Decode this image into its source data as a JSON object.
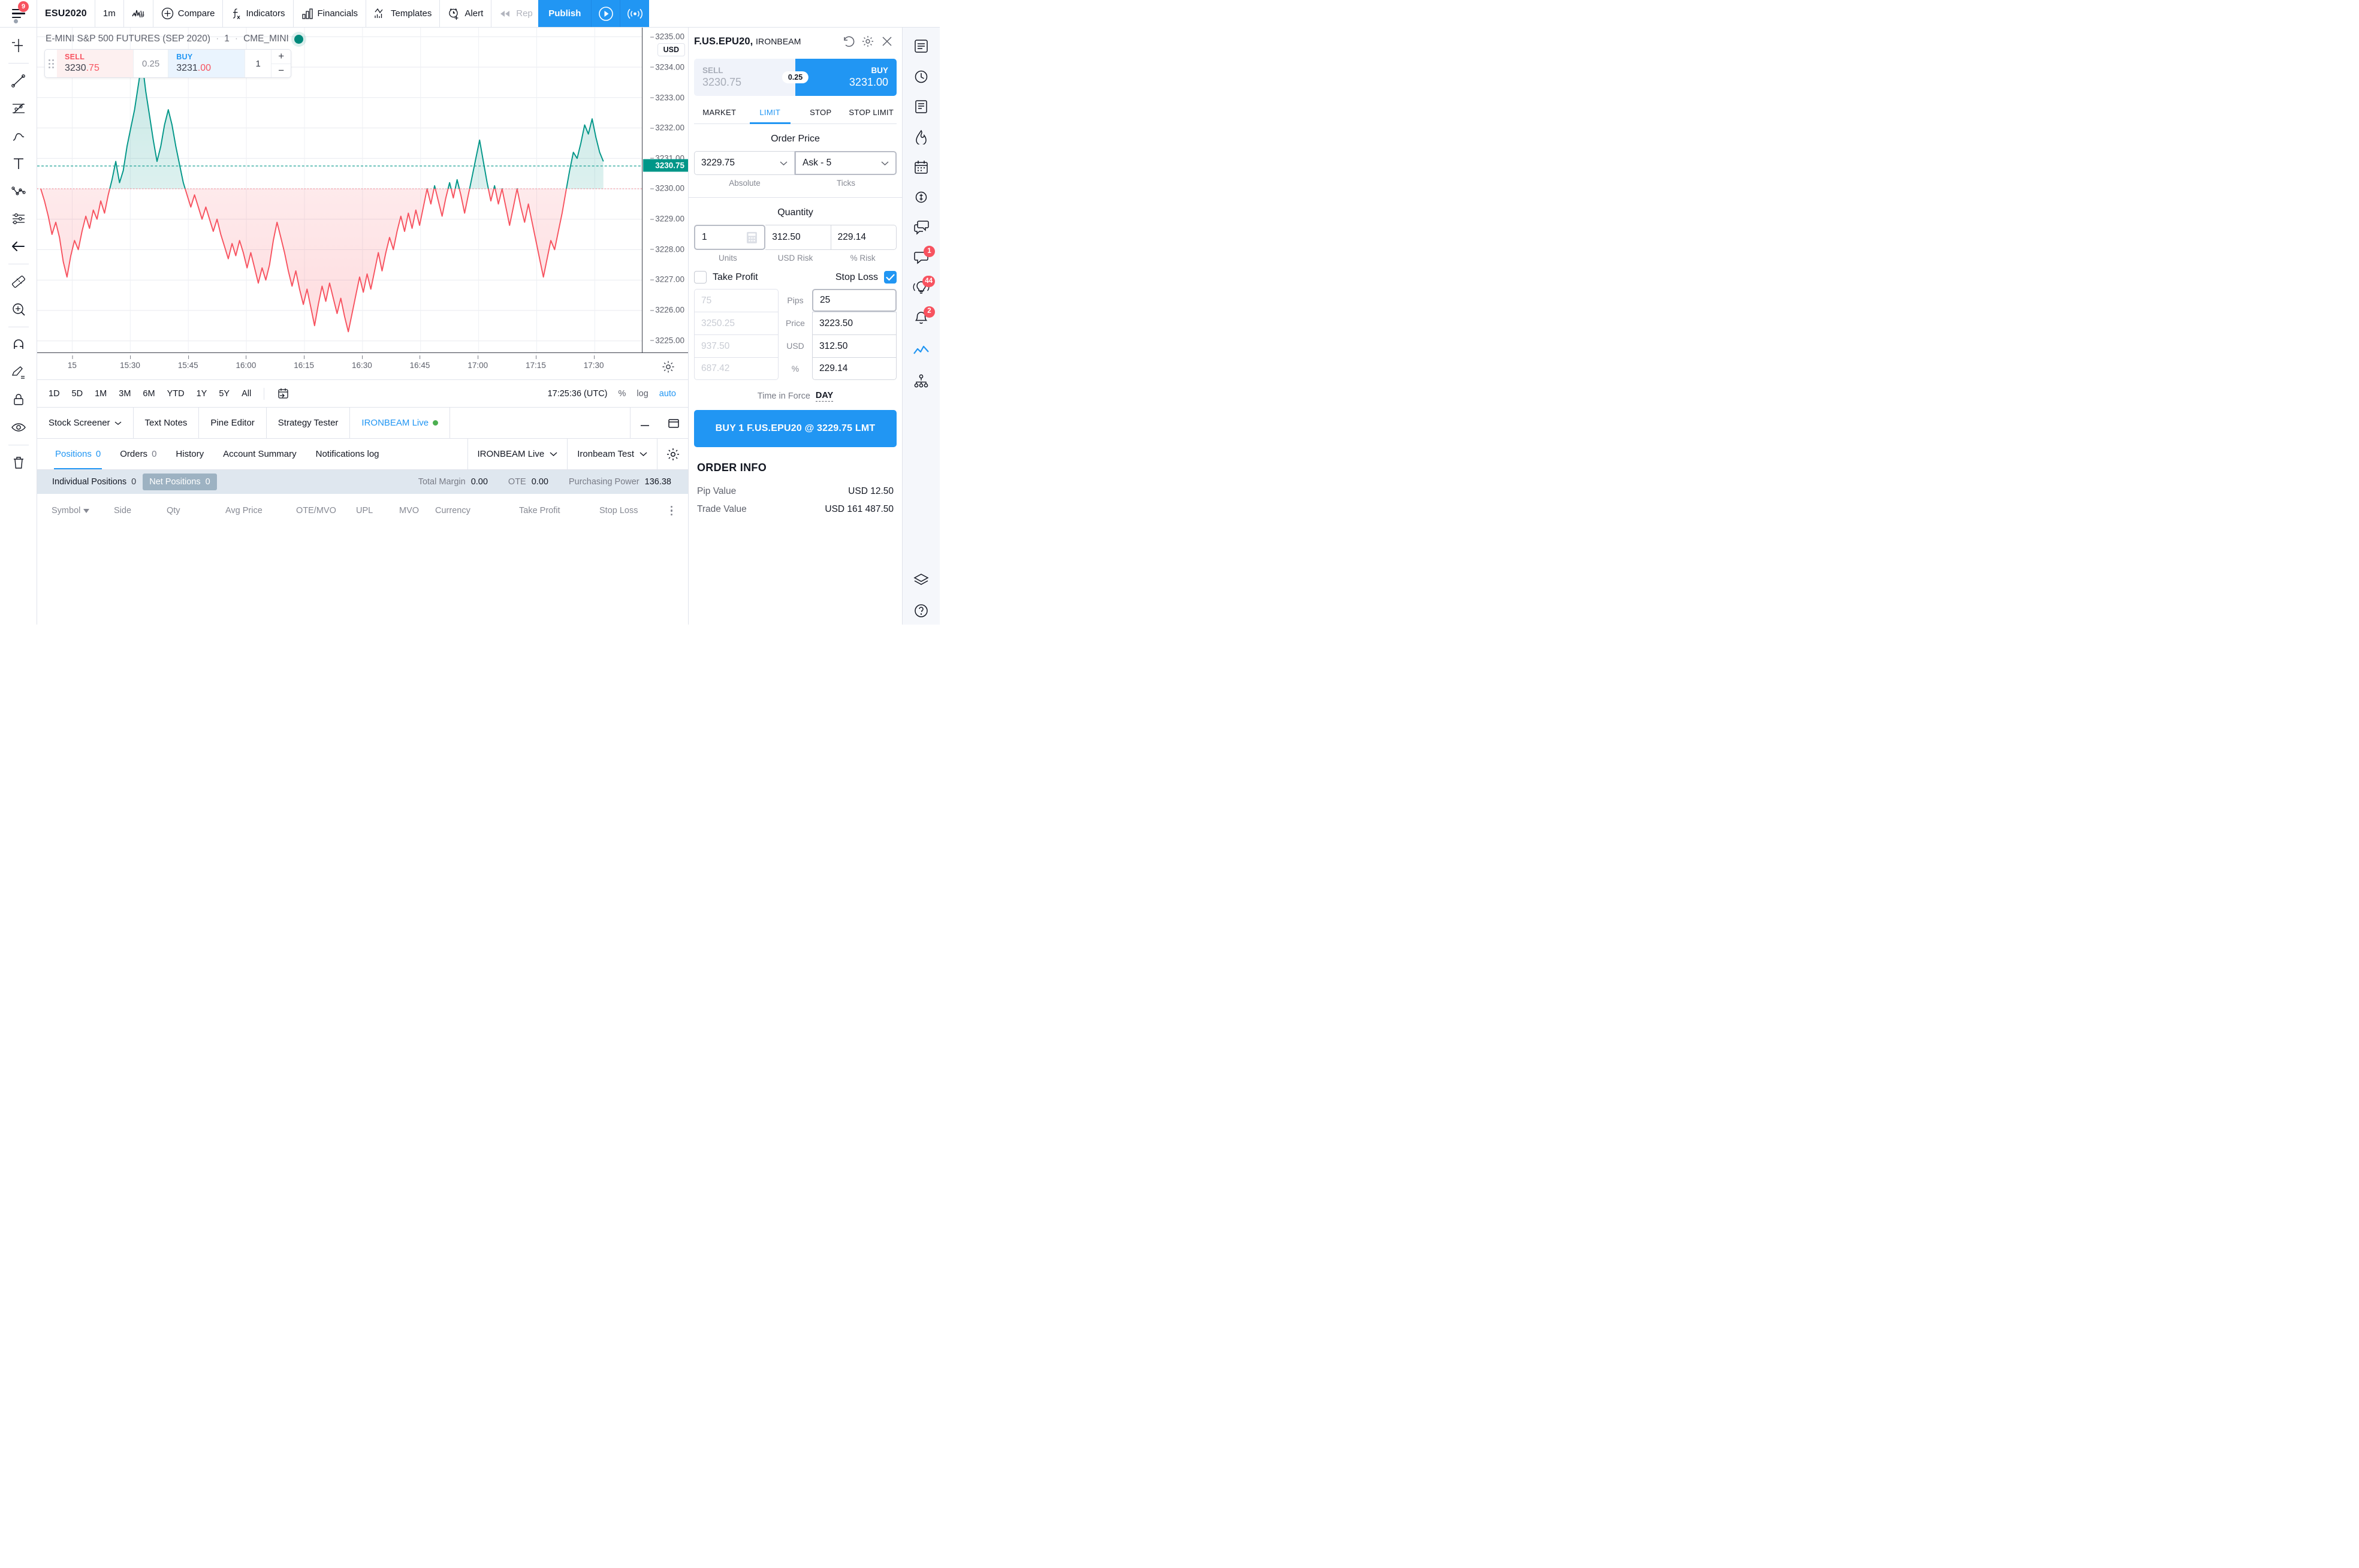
{
  "toolbar": {
    "menu_badge": "9",
    "symbol": "ESU2020",
    "interval": "1m",
    "compare": "Compare",
    "indicators": "Indicators",
    "financials": "Financials",
    "templates": "Templates",
    "alert": "Alert",
    "replay": "Rep",
    "publish": "Publish"
  },
  "chart": {
    "title": "E-MINI S&P 500 FUTURES (SEP 2020)",
    "interval": "1",
    "exchange": "CME_MINI",
    "currency_badge": "USD",
    "widget": {
      "sell_label": "SELL",
      "sell_price_int": "3230",
      "sell_price_dec": ".75",
      "spread": "0.25",
      "buy_label": "BUY",
      "buy_price_int": "3231",
      "buy_price_dec": ".00",
      "qty": "1",
      "plus": "+",
      "minus": "−"
    }
  },
  "chart_data": {
    "type": "line",
    "title": "E-MINI S&P 500 FUTURES (SEP 2020) · 1 · CME_MINI",
    "xlabel": "",
    "ylabel": "USD",
    "ylim": [
      3224.6,
      3235.3
    ],
    "yticks": [
      "3235.00",
      "3234.00",
      "3233.00",
      "3232.00",
      "3231.00",
      "3230.00",
      "3229.00",
      "3228.00",
      "3227.00",
      "3226.00",
      "3225.00"
    ],
    "xticks": [
      "15",
      "15:30",
      "15:45",
      "16:00",
      "16:15",
      "16:30",
      "16:45",
      "17:00",
      "17:15",
      "17:30"
    ],
    "current_price": "3230.75",
    "current_price_color": "#009688",
    "entry_line": "3230.00",
    "up_color": "#009688",
    "down_color": "#f7525f",
    "grid": true,
    "legend": "none",
    "values": [
      3230.0,
      3229.6,
      3229.1,
      3228.5,
      3228.9,
      3228.4,
      3227.6,
      3227.1,
      3227.8,
      3228.3,
      3228.0,
      3228.6,
      3229.1,
      3228.7,
      3229.3,
      3229.0,
      3229.6,
      3229.2,
      3229.8,
      3230.3,
      3230.9,
      3230.2,
      3230.6,
      3231.4,
      3232.0,
      3232.6,
      3233.4,
      3234.2,
      3233.2,
      3232.4,
      3231.6,
      3230.9,
      3231.4,
      3232.1,
      3232.6,
      3232.1,
      3231.4,
      3230.8,
      3230.2,
      3229.8,
      3229.4,
      3229.8,
      3229.4,
      3229.0,
      3229.4,
      3229.0,
      3228.6,
      3229.0,
      3228.5,
      3228.1,
      3227.7,
      3228.2,
      3227.8,
      3228.3,
      3227.9,
      3227.4,
      3227.9,
      3227.4,
      3226.9,
      3227.4,
      3227.0,
      3227.5,
      3228.3,
      3228.9,
      3228.4,
      3227.9,
      3227.3,
      3226.8,
      3227.3,
      3226.7,
      3226.2,
      3226.7,
      3226.1,
      3225.5,
      3226.2,
      3226.8,
      3226.3,
      3226.9,
      3226.4,
      3225.9,
      3226.4,
      3225.8,
      3225.3,
      3225.9,
      3226.5,
      3227.1,
      3226.6,
      3227.2,
      3226.7,
      3227.3,
      3227.9,
      3227.3,
      3227.9,
      3228.4,
      3228.0,
      3228.6,
      3229.1,
      3228.6,
      3229.2,
      3228.7,
      3229.3,
      3228.8,
      3229.4,
      3230.0,
      3229.5,
      3230.1,
      3229.6,
      3229.1,
      3229.7,
      3230.2,
      3229.7,
      3230.3,
      3229.8,
      3229.2,
      3229.8,
      3230.4,
      3231.0,
      3231.6,
      3230.9,
      3230.2,
      3229.6,
      3230.1,
      3229.5,
      3230.0,
      3229.4,
      3228.8,
      3229.4,
      3230.0,
      3229.4,
      3228.9,
      3229.5,
      3228.9,
      3228.3,
      3227.7,
      3227.1,
      3227.7,
      3228.3,
      3228.0,
      3228.6,
      3229.2,
      3229.9,
      3230.6,
      3231.2,
      3231.0,
      3231.5,
      3232.1,
      3231.8,
      3232.3,
      3231.7,
      3231.2,
      3230.9
    ]
  },
  "timeframes": {
    "items": [
      "1D",
      "5D",
      "1M",
      "3M",
      "6M",
      "YTD",
      "1Y",
      "5Y",
      "All"
    ],
    "clock": "17:25:36 (UTC)",
    "percent": "%",
    "log": "log",
    "auto": "auto"
  },
  "bottom": {
    "tabs": [
      {
        "label": "Stock Screener",
        "active": false,
        "caret": true,
        "dot": false
      },
      {
        "label": "Text Notes",
        "active": false,
        "caret": false,
        "dot": false
      },
      {
        "label": "Pine Editor",
        "active": false,
        "caret": false,
        "dot": false
      },
      {
        "label": "Strategy Tester",
        "active": false,
        "caret": false,
        "dot": false
      },
      {
        "label": "IRONBEAM Live",
        "active": true,
        "caret": false,
        "dot": true
      }
    ],
    "subtabs": [
      {
        "label": "Positions",
        "count": "0",
        "active": true
      },
      {
        "label": "Orders",
        "count": "0",
        "active": false
      },
      {
        "label": "History",
        "count": "",
        "active": false
      },
      {
        "label": "Account Summary",
        "count": "",
        "active": false
      },
      {
        "label": "Notifications log",
        "count": "",
        "active": false
      }
    ],
    "broker_select": "IRONBEAM Live",
    "account_select": "Ironbeam Test",
    "posbar": {
      "individual_label": "Individual Positions",
      "individual_count": "0",
      "net_label": "Net Positions",
      "net_count": "0",
      "total_margin_label": "Total Margin",
      "total_margin_value": "0.00",
      "ote_label": "OTE",
      "ote_value": "0.00",
      "purchasing_power_label": "Purchasing Power",
      "purchasing_power_value": "136.38"
    },
    "columns": [
      "Symbol",
      "Side",
      "Qty",
      "Avg Price",
      "OTE/MVO",
      "UPL",
      "MVO",
      "Currency",
      "Take Profit",
      "Stop Loss"
    ],
    "rows": []
  },
  "order_panel": {
    "symbol": "F.US.EPU20,",
    "broker": "IRONBEAM",
    "sell_label": "SELL",
    "sell_price": "3230.75",
    "spread": "0.25",
    "buy_label": "BUY",
    "buy_price": "3231.00",
    "order_types": [
      "MARKET",
      "LIMIT",
      "STOP",
      "STOP LIMIT"
    ],
    "active_order_type": "LIMIT",
    "order_price_title": "Order Price",
    "order_price_value": "3229.75",
    "order_price_label": "Absolute",
    "ticks_value": "Ask - 5",
    "ticks_label": "Ticks",
    "quantity_title": "Quantity",
    "units_value": "1",
    "units_label": "Units",
    "usd_risk_value": "312.50",
    "usd_risk_label": "USD Risk",
    "pct_risk_value": "229.14",
    "pct_risk_label": "% Risk",
    "take_profit_label": "Take Profit",
    "take_profit_checked": false,
    "stop_loss_label": "Stop Loss",
    "stop_loss_checked": true,
    "row_labels": [
      "Pips",
      "Price",
      "USD",
      "%"
    ],
    "take_profit_values": [
      "75",
      "3250.25",
      "937.50",
      "687.42"
    ],
    "stop_loss_values": [
      "25",
      "3223.50",
      "312.50",
      "229.14"
    ],
    "tif_label": "Time in Force",
    "tif_value": "DAY",
    "submit_label": "BUY 1 F.US.EPU20 @ 3229.75 LMT",
    "order_info_title": "ORDER INFO",
    "info_rows": [
      {
        "key": "Pip Value",
        "value": "USD 12.50"
      },
      {
        "key": "Trade Value",
        "value": "USD 161 487.50"
      }
    ]
  },
  "right_rail": {
    "badges": {
      "chat": "1",
      "ideas": "44",
      "alerts": "2"
    }
  },
  "colors": {
    "accent": "#2196f3",
    "up": "#009688",
    "down": "#f7525f",
    "badge": "#f7525f"
  }
}
